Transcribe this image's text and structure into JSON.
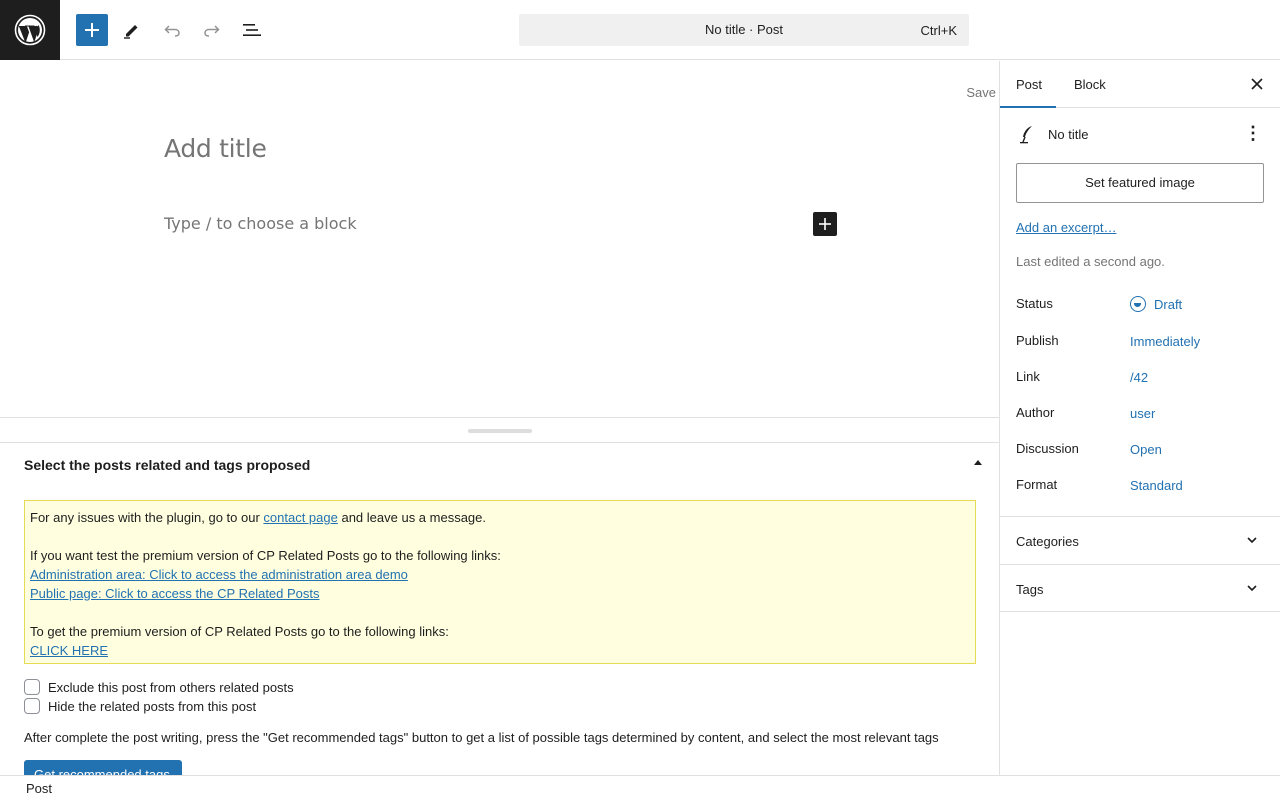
{
  "topbar": {
    "command_bar_title": "No title · Post",
    "command_bar_shortcut": "Ctrl+K"
  },
  "editor": {
    "save_label": "Save",
    "title_placeholder": "Add title",
    "block_placeholder": "Type / to choose a block"
  },
  "metabox": {
    "title": "Select the posts related and tags proposed",
    "notice": {
      "line1_prefix": "For any issues with the plugin, go to our ",
      "line1_link": "contact page",
      "line1_suffix": " and leave us a message.",
      "line2": "If you want test the premium version of CP Related Posts go to the following links:",
      "admin_link": "Administration area: Click to access the administration area demo",
      "public_link": "Public page: Click to access the CP Related Posts",
      "line3": "To get the premium version of CP Related Posts go to the following links:",
      "click_here": "CLICK HERE"
    },
    "checkbox_exclude": "Exclude this post from others related posts",
    "checkbox_hide": "Hide the related posts from this post",
    "after_text": "After complete the post writing, press the \"Get recommended tags\" button to get a list of possible tags determined by content, and select the most relevant tags",
    "recommend_button": "Get recommended tags"
  },
  "footer": {
    "breadcrumb": "Post"
  },
  "sidebar": {
    "tabs": [
      {
        "label": "Post",
        "active": true
      },
      {
        "label": "Block",
        "active": false
      }
    ],
    "post_title": "No title",
    "featured_image_button": "Set featured image",
    "excerpt_link": "Add an excerpt…",
    "last_edited": "Last edited a second ago.",
    "summary": [
      {
        "label": "Status",
        "value": "Draft"
      },
      {
        "label": "Publish",
        "value": "Immediately"
      },
      {
        "label": "Link",
        "value": "/42"
      },
      {
        "label": "Author",
        "value": "user"
      },
      {
        "label": "Discussion",
        "value": "Open"
      },
      {
        "label": "Format",
        "value": "Standard"
      }
    ],
    "panels": [
      {
        "label": "Categories"
      },
      {
        "label": "Tags"
      }
    ]
  },
  "colors": {
    "accent": "#2271b1",
    "dark": "#1e1e1e",
    "notice_bg": "#ffffe0",
    "notice_border": "#e6db55"
  }
}
